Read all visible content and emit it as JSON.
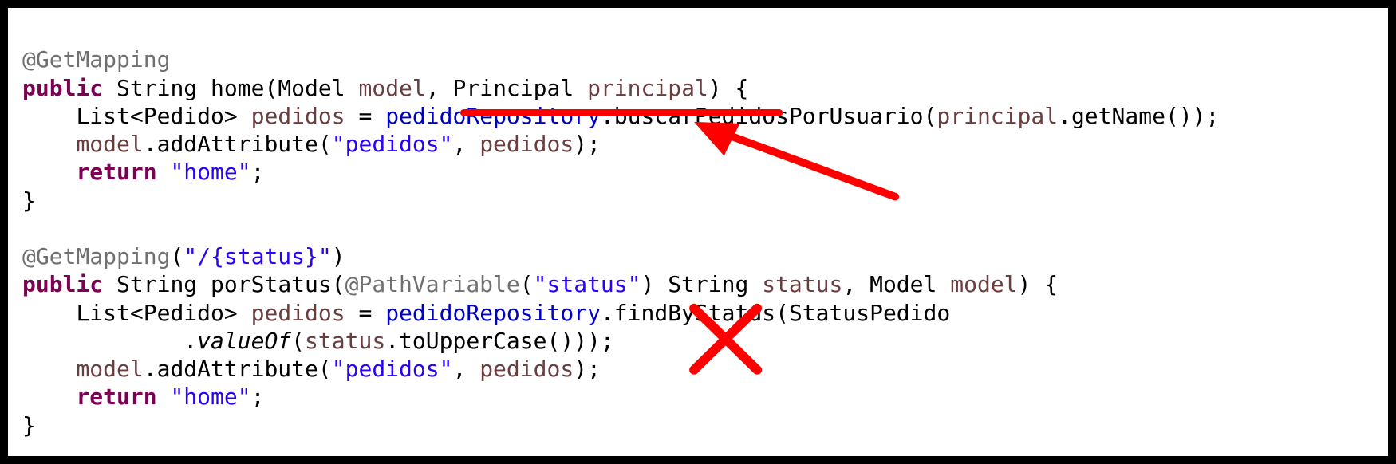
{
  "code": {
    "m1": {
      "ann": "@GetMapping",
      "kw_public": "public",
      "type_string": "String",
      "name": "home",
      "p1_type": "Model",
      "p1_name": "model",
      "p2_type": "Principal",
      "p2_name": "principal",
      "list_type": "List",
      "pedido_type": "Pedido",
      "var_pedidos": "pedidos",
      "repo": "pedidoRepository",
      "repo_method": "buscarPedidosPorUsuario",
      "principal_var": "principal",
      "getname": "getName",
      "model_var": "model",
      "addattr": "addAttribute",
      "attr_key": "\"pedidos\"",
      "attr_val": "pedidos",
      "kw_return": "return",
      "ret_val": "\"home\""
    },
    "m2": {
      "ann": "@GetMapping",
      "ann_arg": "\"/{status}\"",
      "kw_public": "public",
      "type_string": "String",
      "name": "porStatus",
      "pv_ann": "@PathVariable",
      "pv_arg": "\"status\"",
      "p1_type": "String",
      "p1_name": "status",
      "p2_type": "Model",
      "p2_name": "model",
      "list_type": "List",
      "pedido_type": "Pedido",
      "var_pedidos": "pedidos",
      "repo": "pedidoRepository",
      "repo_method": "findByStatus",
      "enum_type": "StatusPedido",
      "valueof": "valueOf",
      "status_var": "status",
      "toupper": "toUpperCase",
      "model_var": "model",
      "addattr": "addAttribute",
      "attr_key": "\"pedidos\"",
      "attr_val": "pedidos",
      "kw_return": "return",
      "ret_val": "\"home\""
    }
  },
  "annotations": {
    "underline_target": "buscarPedidosPorUsuario",
    "x_mark": "incorrect-marker"
  }
}
